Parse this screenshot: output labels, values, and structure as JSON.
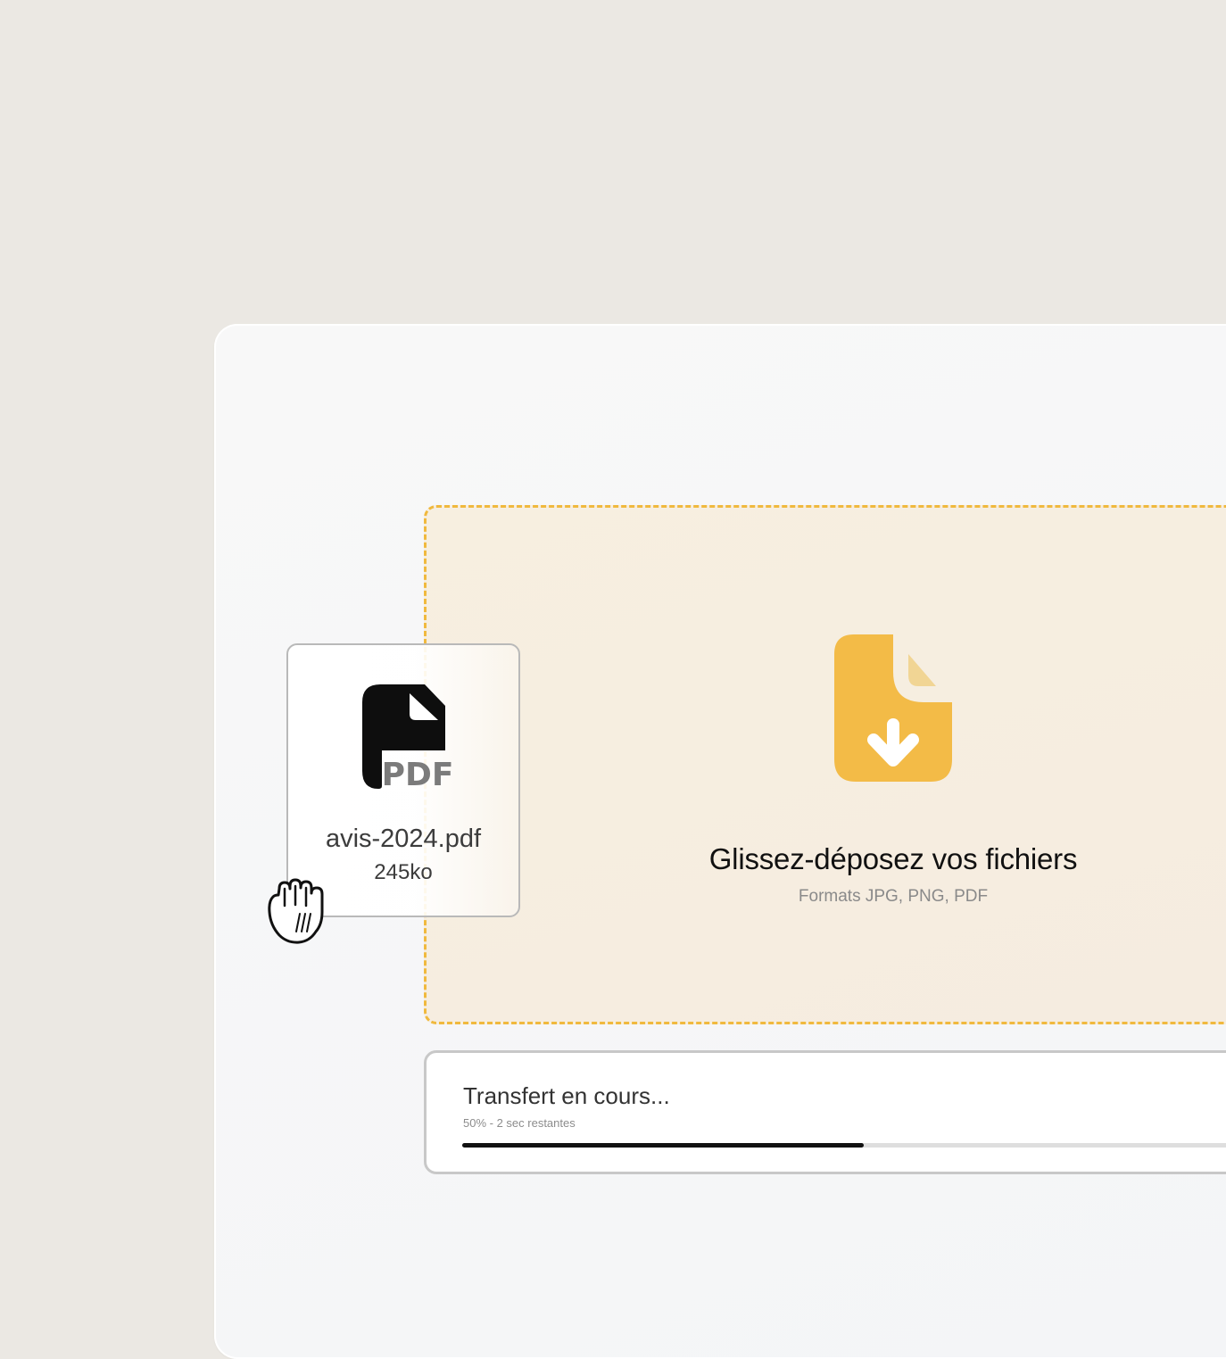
{
  "colors": {
    "background": "#ebe8e3",
    "accent": "#f0b93e",
    "dropzone_fill": "#f7efe0",
    "progress": "#111111"
  },
  "dropzone": {
    "icon": "file-download-icon",
    "title": "Glissez-déposez vos fichiers",
    "subtitle": "Formats JPG, PNG, PDF"
  },
  "dragged_file": {
    "icon": "pdf-file-icon",
    "icon_label": "PDF",
    "name": "avis-2024.pdf",
    "size": "245ko"
  },
  "cursor": {
    "icon": "grab-hand-icon"
  },
  "transfer": {
    "title": "Transfert en cours...",
    "status": "50% - 2 sec restantes",
    "progress": 0.5
  }
}
